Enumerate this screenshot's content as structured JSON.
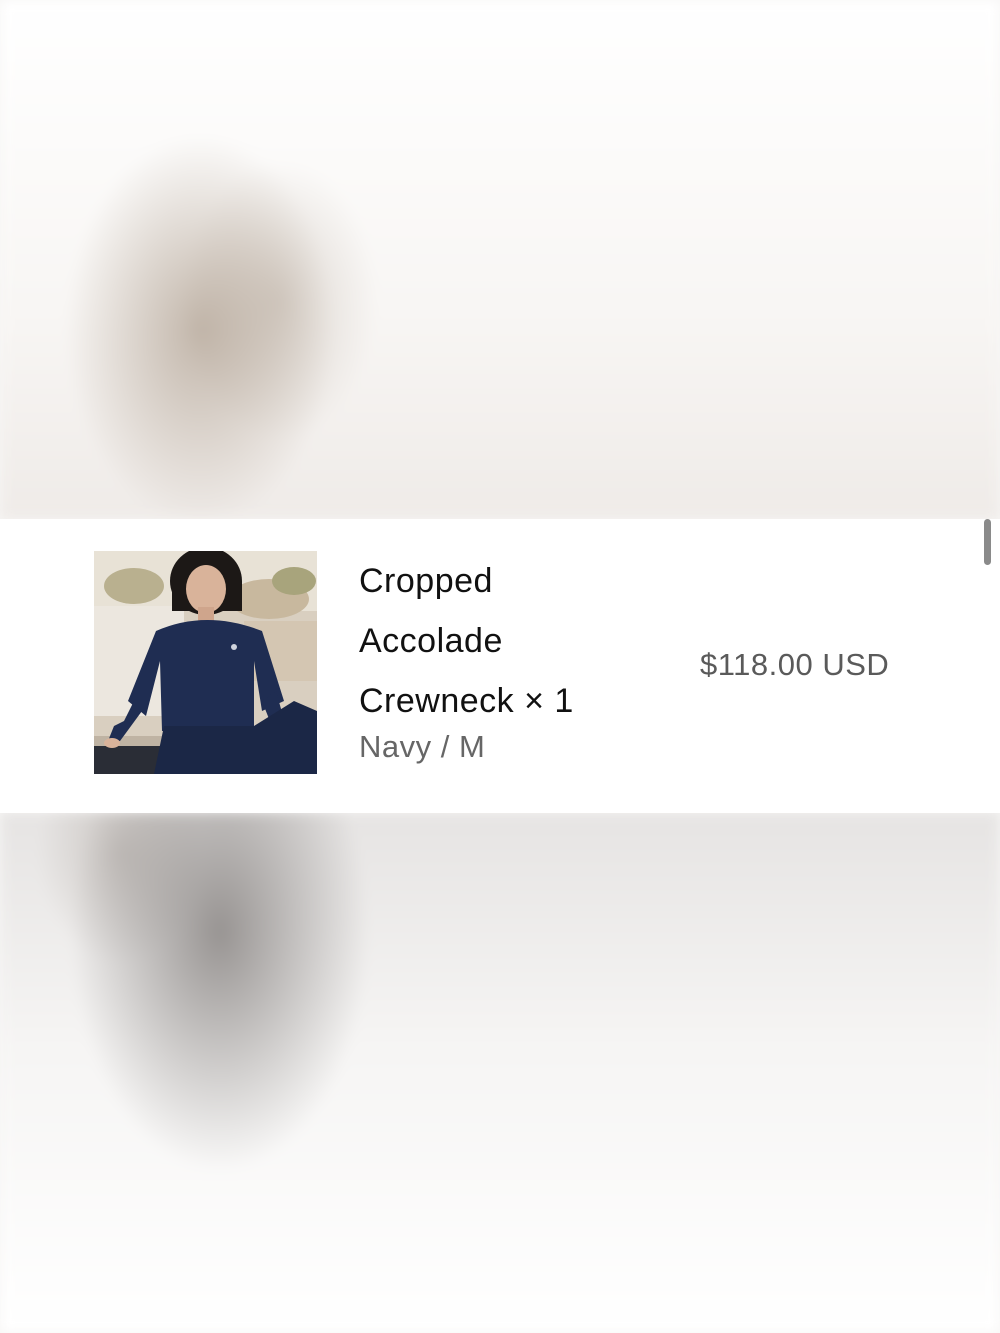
{
  "line_item": {
    "title_line1": "Cropped",
    "title_line2": "Accolade",
    "title_line3": "Crewneck",
    "quantity": "× 1",
    "variant": "Navy / M",
    "price": "$118.00 USD",
    "image_icon": "product-photo"
  },
  "colors": {
    "title": "#111111",
    "variant": "#666666",
    "price": "#5a5a5a",
    "product_navy": "#1f2d52"
  }
}
